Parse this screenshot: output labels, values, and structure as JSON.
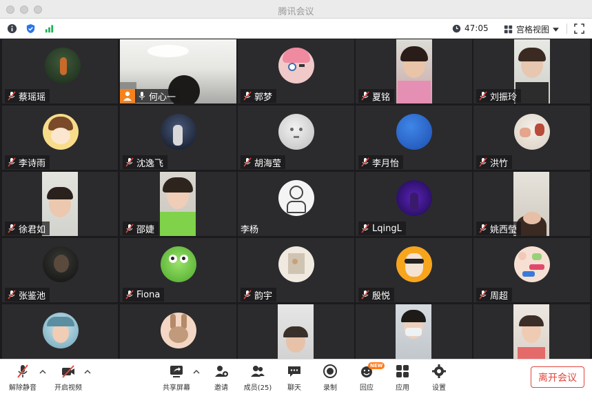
{
  "window": {
    "title": "腾讯会议"
  },
  "infobar": {
    "timer": "47:05",
    "view_label": "宫格视图"
  },
  "participants": [
    "蔡瑶瑶",
    "何心一",
    "郭梦",
    "夏铭",
    "刘振玲",
    "李诗雨",
    "沈逸飞",
    "胡海莹",
    "李月怡",
    "洪竹",
    "徐君如",
    "邵婕",
    "李杨",
    "LqingL",
    "姚西瑩",
    "张鉴池",
    "Fiona",
    "韵宇",
    "殷悦",
    "周超"
  ],
  "toolbar": {
    "unmute": "解除静音",
    "start_video": "开启视频",
    "share_screen": "共享屏幕",
    "invite": "邀请",
    "members": "成员(25)",
    "chat": "聊天",
    "record": "录制",
    "reactions": "回应",
    "apps": "应用",
    "settings": "设置",
    "leave": "离开会议",
    "new_badge": "NEW"
  },
  "colors": {
    "leave_red": "#e2443a",
    "tile_bg": "#2b2b2d",
    "muted_red": "#e0483e",
    "speaker_orange": "#f7821b"
  }
}
